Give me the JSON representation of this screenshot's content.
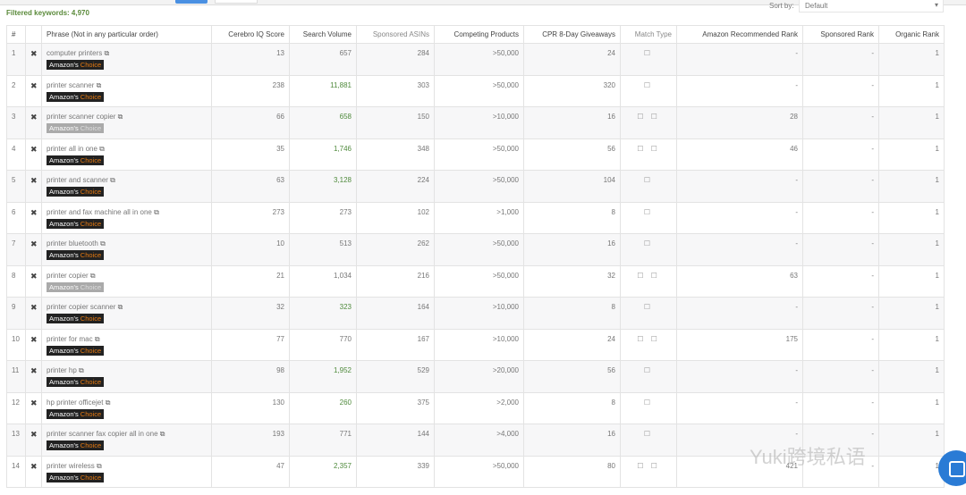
{
  "filtered_label": "Filtered keywords: 4,970",
  "sort": {
    "label": "Sort by:",
    "value": "Default"
  },
  "headers": [
    "#",
    "",
    "Phrase (Not in any particular order)",
    "Cerebro IQ Score",
    "Search Volume",
    "Sponsored ASINs",
    "Competing Products",
    "CPR 8-Day Giveaways",
    "Match Type",
    "Amazon Recommended Rank",
    "Sponsored Rank",
    "Organic Rank"
  ],
  "badge": {
    "a": "Amazon's",
    "b": "Choice"
  },
  "remove_icon": "✖",
  "ext_icon": "⧉",
  "watermark": "Yuki跨境私语",
  "rows": [
    {
      "n": "1",
      "phrase": "computer printers",
      "badge": "dark",
      "iq": "13",
      "sv": "657",
      "svg": false,
      "sa": "284",
      "cp": ">50,000",
      "cpr": "24",
      "mt": "☐",
      "arr": "-",
      "sr": "-",
      "or": "1"
    },
    {
      "n": "2",
      "phrase": "printer scanner",
      "badge": "dark",
      "iq": "238",
      "sv": "11,881",
      "svg": true,
      "sa": "303",
      "cp": ">50,000",
      "cpr": "320",
      "mt": "☐",
      "arr": "-",
      "sr": "-",
      "or": "1"
    },
    {
      "n": "3",
      "phrase": "printer scanner copier",
      "badge": "grey",
      "iq": "66",
      "sv": "658",
      "svg": true,
      "sa": "150",
      "cp": ">10,000",
      "cpr": "16",
      "mt": "☐ ☐",
      "arr": "28",
      "sr": "-",
      "or": "1"
    },
    {
      "n": "4",
      "phrase": "printer all in one",
      "badge": "dark",
      "iq": "35",
      "sv": "1,746",
      "svg": true,
      "sa": "348",
      "cp": ">50,000",
      "cpr": "56",
      "mt": "☐ ☐",
      "arr": "46",
      "sr": "-",
      "or": "1"
    },
    {
      "n": "5",
      "phrase": "printer and scanner",
      "badge": "dark",
      "iq": "63",
      "sv": "3,128",
      "svg": true,
      "sa": "224",
      "cp": ">50,000",
      "cpr": "104",
      "mt": "☐",
      "arr": "-",
      "sr": "-",
      "or": "1"
    },
    {
      "n": "6",
      "phrase": "printer and fax machine all in one",
      "badge": "dark",
      "iq": "273",
      "sv": "273",
      "svg": false,
      "sa": "102",
      "cp": ">1,000",
      "cpr": "8",
      "mt": "☐",
      "arr": "-",
      "sr": "-",
      "or": "1"
    },
    {
      "n": "7",
      "phrase": "printer bluetooth",
      "badge": "dark",
      "iq": "10",
      "sv": "513",
      "svg": false,
      "sa": "262",
      "cp": ">50,000",
      "cpr": "16",
      "mt": "☐",
      "arr": "-",
      "sr": "-",
      "or": "1"
    },
    {
      "n": "8",
      "phrase": "printer copier",
      "badge": "grey",
      "iq": "21",
      "sv": "1,034",
      "svg": false,
      "sa": "216",
      "cp": ">50,000",
      "cpr": "32",
      "mt": "☐ ☐",
      "arr": "63",
      "sr": "-",
      "or": "1"
    },
    {
      "n": "9",
      "phrase": "printer copier scanner",
      "badge": "dark",
      "iq": "32",
      "sv": "323",
      "svg": true,
      "sa": "164",
      "cp": ">10,000",
      "cpr": "8",
      "mt": "☐",
      "arr": "-",
      "sr": "-",
      "or": "1"
    },
    {
      "n": "10",
      "phrase": "printer for mac",
      "badge": "dark",
      "iq": "77",
      "sv": "770",
      "svg": false,
      "sa": "167",
      "cp": ">10,000",
      "cpr": "24",
      "mt": "☐ ☐",
      "arr": "175",
      "sr": "-",
      "or": "1"
    },
    {
      "n": "11",
      "phrase": "printer hp",
      "badge": "dark",
      "iq": "98",
      "sv": "1,952",
      "svg": true,
      "sa": "529",
      "cp": ">20,000",
      "cpr": "56",
      "mt": "☐",
      "arr": "-",
      "sr": "-",
      "or": "1"
    },
    {
      "n": "12",
      "phrase": "hp printer officejet",
      "badge": "dark",
      "iq": "130",
      "sv": "260",
      "svg": true,
      "sa": "375",
      "cp": ">2,000",
      "cpr": "8",
      "mt": "☐",
      "arr": "-",
      "sr": "-",
      "or": "1"
    },
    {
      "n": "13",
      "phrase": "printer scanner fax copier all in one",
      "badge": "dark",
      "iq": "193",
      "sv": "771",
      "svg": false,
      "sa": "144",
      "cp": ">4,000",
      "cpr": "16",
      "mt": "☐",
      "arr": "-",
      "sr": "-",
      "or": "1"
    },
    {
      "n": "14",
      "phrase": "printer wireless",
      "badge": "dark",
      "iq": "47",
      "sv": "2,357",
      "svg": true,
      "sa": "339",
      "cp": ">50,000",
      "cpr": "80",
      "mt": "☐ ☐",
      "arr": "421",
      "sr": "-",
      "or": "1"
    }
  ]
}
